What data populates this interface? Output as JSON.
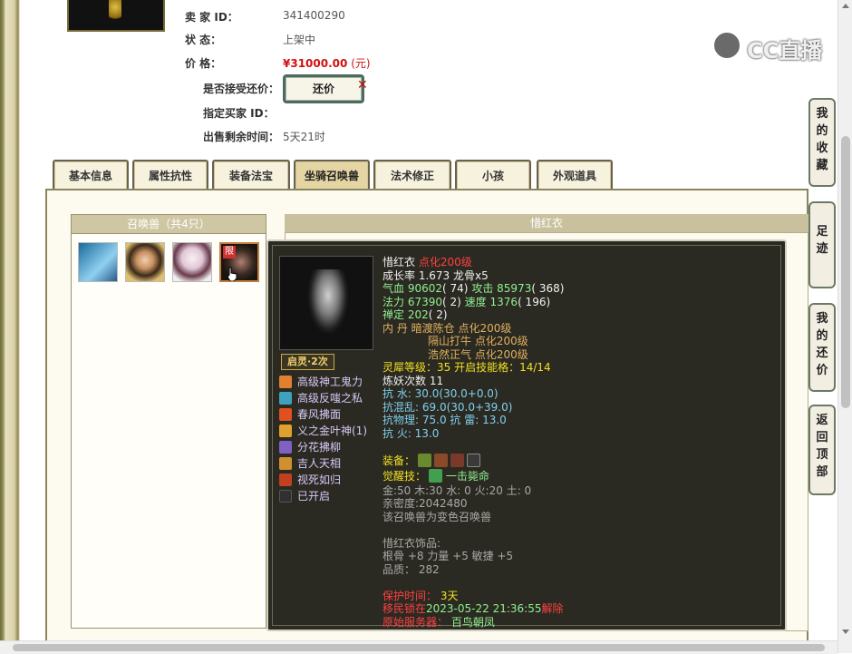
{
  "seller": {
    "id_label": "卖 家   ID：",
    "id_value": "341400290",
    "status_label": "状     态：",
    "status_value": "上架中",
    "price_label": "价     格：",
    "price_value": "¥31000.00",
    "price_unit": "(元)",
    "counter_label": "是否接受还价：",
    "counter_button": "还价",
    "buyer_label": "指定买家 ID：",
    "remaining_label": "出售剩余时间：",
    "remaining_value": "5天21时"
  },
  "watermark": {
    "text": "CC直播"
  },
  "tabs": [
    {
      "label": "基本信息"
    },
    {
      "label": "属性抗性"
    },
    {
      "label": "装备法宝"
    },
    {
      "label": "坐骑召唤兽",
      "active": true
    },
    {
      "label": "法术修正"
    },
    {
      "label": "小孩"
    },
    {
      "label": "外观道具"
    }
  ],
  "pet_list": {
    "header": "召唤兽（共4只）",
    "badge": "限"
  },
  "detail": {
    "header": "惜红衣"
  },
  "tooltip": {
    "ling_badge": "启灵·2次",
    "skills": [
      {
        "name": "高级神工鬼力",
        "color": "#e08030"
      },
      {
        "name": "高级反嗤之私",
        "color": "#40a0c0"
      },
      {
        "name": "春风拂面",
        "color": "#e05020"
      },
      {
        "name": "义之金叶神(1)",
        "color": "#e0a030"
      },
      {
        "name": "分花拂柳",
        "color": "#8060c0"
      },
      {
        "name": "吉人天相",
        "color": "#d09030"
      },
      {
        "name": "视死如归",
        "color": "#c04020"
      },
      {
        "name": "已开启",
        "color": "#303030"
      }
    ],
    "name": "惜红衣",
    "name_suffix": "点化200级",
    "growth": "成长率 1.673 龙骨x5",
    "hp_label": "气血",
    "hp_value": "90602",
    "hp_extra": "( 74)",
    "atk_label": "攻击",
    "atk_value": "85973",
    "atk_extra": "( 368)",
    "mp_label": "法力",
    "mp_value": "67390",
    "mp_extra": "( 2)",
    "spd_label": "速度",
    "spd_value": "1376",
    "spd_extra": "( 196)",
    "zen_label": "禅定",
    "zen_value": "202",
    "zen_extra": "( 2)",
    "dan_label": "内    丹",
    "dan_1": "暗渡陈仓 点化200级",
    "dan_2": "隔山打牛 点化200级",
    "dan_3": "浩然正气 点化200级",
    "lingxi": "灵犀等级：35 开启技能格：14/14",
    "lianyao": "炼妖次数 11",
    "res_water": "抗    水: 30.0(30.0+0.0)",
    "res_chaos": "抗混乱: 69.0(30.0+39.0)",
    "res_phys": "抗物理: 75.0 抗    雷: 13.0",
    "res_fire": "抗    火: 13.0",
    "equip_label": "装备：",
    "awaken_label": "觉醒技：",
    "awaken_value": "一击毙命",
    "elements": "金:50 木:30 水: 0 火:20 土: 0",
    "intimacy": "亲密度:2042480",
    "variant": "该召唤兽为变色召唤兽",
    "ornament_title": "惜红衣饰品:",
    "ornament_stats": "根骨 +8 力量 +5 敏捷 +5",
    "ornament_quality": "品质： 282",
    "protect_label": "保护时间：",
    "protect_value": "3天",
    "migrate_prefix": "移民锁在",
    "migrate_date": "2023-05-22 21:36:55",
    "migrate_suffix": "解除",
    "origin_label": "原始服务器：",
    "origin_value": "百鸟朝凤"
  },
  "side_buttons": [
    {
      "label": "我的收藏"
    },
    {
      "label": "足迹"
    },
    {
      "label": "我的还价"
    },
    {
      "label": "返回顶部"
    }
  ]
}
